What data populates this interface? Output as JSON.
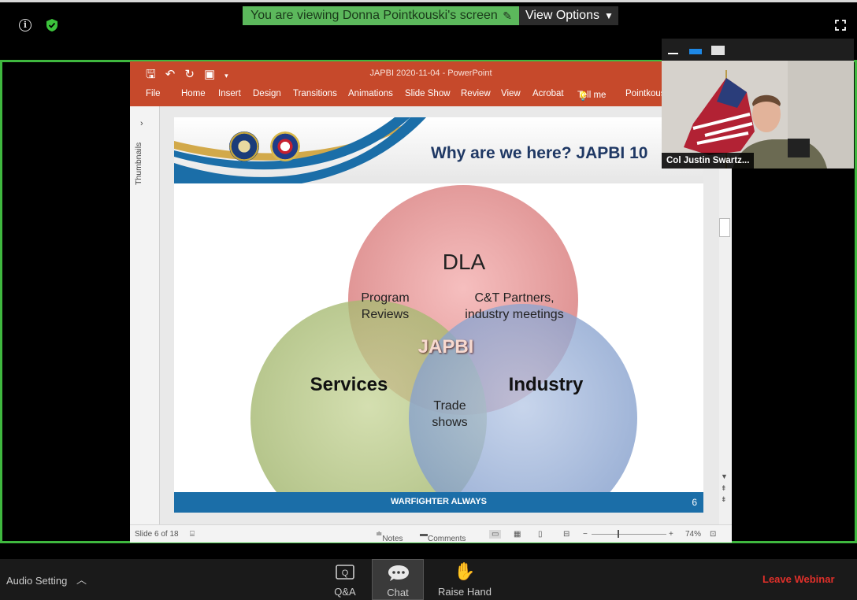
{
  "zoom": {
    "viewing_banner": "You are viewing Donna Pointkouski's screen",
    "view_options": "View Options",
    "icons": [
      "info-icon",
      "shield-check-icon",
      "fullscreen-icon",
      "pen-icon"
    ],
    "accent_green": "#3fb83f"
  },
  "powerpoint": {
    "title": "JAPBI 2020-11-04  -  PowerPoint",
    "ribbon_tabs": [
      "File",
      "Home",
      "Insert",
      "Design",
      "Transitions",
      "Animations",
      "Slide Show",
      "Review",
      "View",
      "Acrobat",
      "Tell me",
      "Pointkous"
    ],
    "thumbnails_label": "Thumbnails",
    "status": {
      "slide_info": "Slide 6 of 18",
      "notes": "Notes",
      "comments": "Comments",
      "zoom": "74%",
      "minus": "−",
      "plus": "+"
    },
    "brand_color": "#c6492b"
  },
  "slide": {
    "title": "Why are we here? JAPBI 10",
    "circles": {
      "top": "DLA",
      "left": "Services",
      "right": "Industry",
      "center": "JAPBI"
    },
    "overlaps": {
      "top_left_1": "Program",
      "top_left_2": "Reviews",
      "top_right_1": "C&T Partners,",
      "top_right_2": "industry meetings",
      "bottom_1": "Trade",
      "bottom_2": "shows"
    },
    "footer": "WARFIGHTER ALWAYS",
    "number": "6"
  },
  "webcam": {
    "name": "Col Justin Swartz..."
  },
  "bottom": {
    "audio": "Audio Setting",
    "qa": "Q&A",
    "chat": "Chat",
    "raise_hand": "Raise Hand",
    "leave": "Leave Webinar"
  }
}
